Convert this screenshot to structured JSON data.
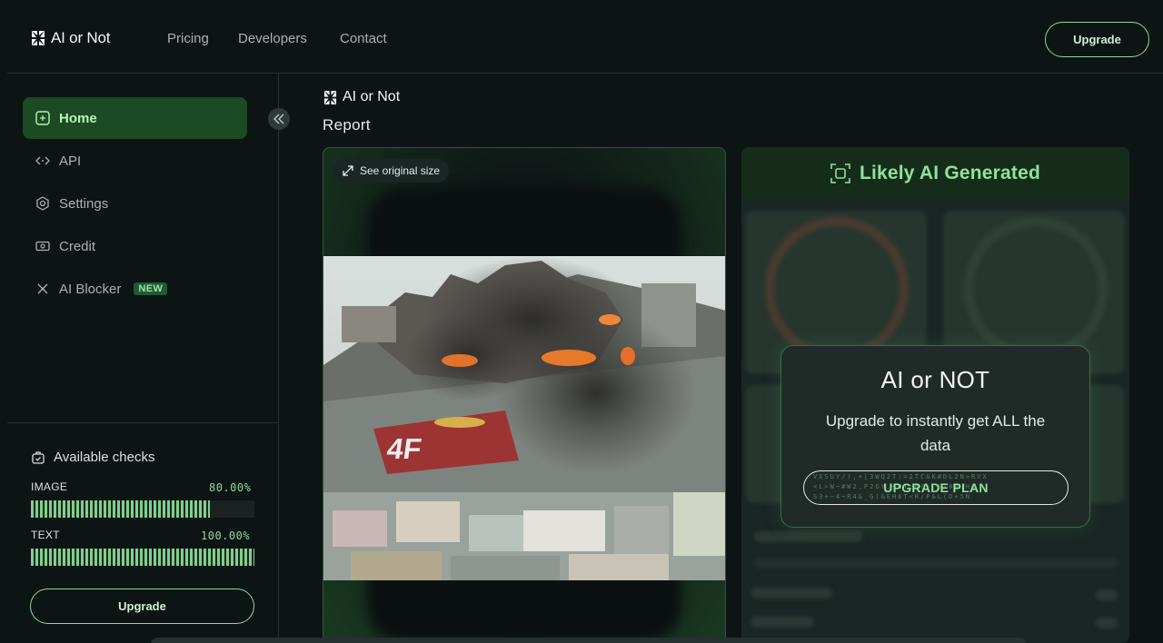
{
  "brand": {
    "name": "AI or Not"
  },
  "topnav": {
    "links": [
      "Pricing",
      "Developers",
      "Contact"
    ],
    "upgrade_label": "Upgrade"
  },
  "sidebar": {
    "items": [
      {
        "label": "Home",
        "icon": "home-icon",
        "active": true
      },
      {
        "label": "API",
        "icon": "code-icon"
      },
      {
        "label": "Settings",
        "icon": "gear-icon"
      },
      {
        "label": "Credit",
        "icon": "credit-icon"
      },
      {
        "label": "AI Blocker",
        "icon": "blocker-icon",
        "badge": "NEW"
      }
    ],
    "checks": {
      "title": "Available checks",
      "image": {
        "label": "IMAGE",
        "value": "80.00%",
        "fraction": 0.8
      },
      "text": {
        "label": "TEXT",
        "value": "100.00%",
        "fraction": 1.0
      }
    },
    "upgrade_label": "Upgrade"
  },
  "main": {
    "brand_name": "AI or Not",
    "title": "Report",
    "see_original_label": "See original size",
    "result_label": "Likely AI Generated",
    "modal": {
      "title": "AI or NOT",
      "text": "Upgrade to instantly get ALL the data",
      "button_label": "UPGRADE PLAN"
    }
  },
  "colors": {
    "accent": "#8ee39a",
    "active_bg": "#1b4a23",
    "background": "#0d1414"
  }
}
